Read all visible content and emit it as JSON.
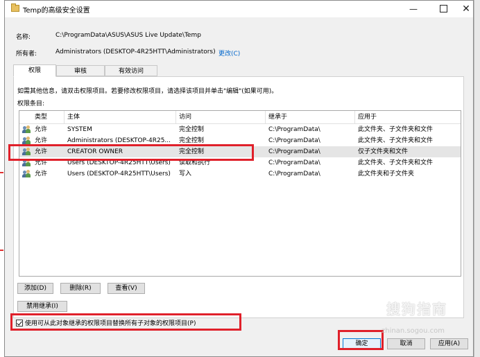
{
  "window": {
    "title": "Temp的高级安全设置"
  },
  "info": {
    "name_label": "名称:",
    "name_value": "C:\\ProgramData\\ASUS\\ASUS Live Update\\Temp",
    "owner_label": "所有者:",
    "owner_value": "Administrators (DESKTOP-4R25HTT\\Administrators)",
    "change_link": "更改(C)"
  },
  "tabs": [
    {
      "label": "权限",
      "active": true
    },
    {
      "label": "审核",
      "active": false
    },
    {
      "label": "有效访问",
      "active": false
    }
  ],
  "instructions": "如需其他信息，请双击权限项目。若要修改权限项目，请选择该项目并单击\"编辑\"(如果可用)。",
  "entries_label": "权限条目:",
  "table": {
    "columns": [
      "类型",
      "主体",
      "访问",
      "继承于",
      "应用于"
    ],
    "rows": [
      {
        "type": "允许",
        "principal": "SYSTEM",
        "access": "完全控制",
        "inherited": "C:\\ProgramData\\",
        "applies": "此文件夹、子文件夹和文件",
        "selected": false
      },
      {
        "type": "允许",
        "principal": "Administrators (DESKTOP-4R25...",
        "access": "完全控制",
        "inherited": "C:\\ProgramData\\",
        "applies": "此文件夹、子文件夹和文件",
        "selected": false
      },
      {
        "type": "允许",
        "principal": "CREATOR OWNER",
        "access": "完全控制",
        "inherited": "C:\\ProgramData\\",
        "applies": "仅子文件夹和文件",
        "selected": true
      },
      {
        "type": "允许",
        "principal": "Users (DESKTOP-4R25HTT\\Users)",
        "access": "读取和执行",
        "inherited": "C:\\ProgramData\\",
        "applies": "此文件夹、子文件夹和文件",
        "selected": false
      },
      {
        "type": "允许",
        "principal": "Users (DESKTOP-4R25HTT\\Users)",
        "access": "写入",
        "inherited": "C:\\ProgramData\\",
        "applies": "此文件夹和子文件夹",
        "selected": false
      }
    ]
  },
  "buttons": {
    "add": "添加(D)",
    "remove": "删除(R)",
    "view": "查看(V)",
    "disable_inheritance": "禁用继承(I)",
    "ok": "确定",
    "cancel": "取消",
    "apply": "应用(A)"
  },
  "replace_checkbox": {
    "label": "使用可从此对象继承的权限项目替换所有子对象的权限项目(P)",
    "checked": true
  },
  "watermark": {
    "text": "搜狗指南",
    "url": "zhinan.sogou.com",
    "symbol": "S"
  },
  "colors": {
    "highlight_box": "#e0202a",
    "link": "#0066cc",
    "selected_row": "#e5e5e5"
  }
}
